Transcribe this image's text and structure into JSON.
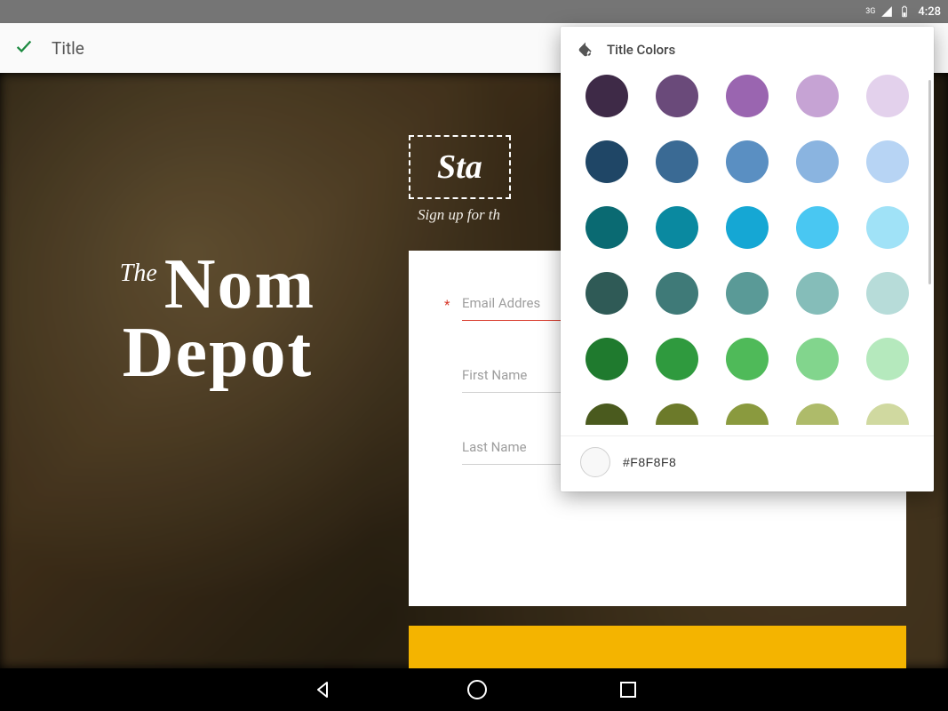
{
  "statusbar": {
    "network_label": "3G",
    "clock": "4:28"
  },
  "toolbar": {
    "title": "Title"
  },
  "brand": {
    "prefix": "The",
    "word1": "Nom",
    "word2": "Depot"
  },
  "hero": {
    "headline_partial": "Sta",
    "subtext_partial": "Sign up for th"
  },
  "form": {
    "email_placeholder": "Email Addres",
    "first_name_placeholder": "First Name",
    "last_name_placeholder": "Last Name",
    "required_mark": "*"
  },
  "panel": {
    "title": "Title Colors",
    "hex_value": "#F8F8F8",
    "swatches": [
      "#3e2a47",
      "#6a4a7a",
      "#9a65b0",
      "#c6a3d4",
      "#e3d1ec",
      "#1f4666",
      "#3a6a94",
      "#5a8fc2",
      "#8ab4e0",
      "#b7d4f4",
      "#0a6a72",
      "#0a89a0",
      "#15a7d4",
      "#49c7f2",
      "#a0e2f7",
      "#2f5a56",
      "#3f7a78",
      "#5a9a97",
      "#85bdb9",
      "#b7dcd9",
      "#1f7a2e",
      "#2f9a3e",
      "#4fba59",
      "#82d58d",
      "#b5e9bd",
      "#4a5a1e",
      "#6c7a2a",
      "#8a9a3e",
      "#aebb6a",
      "#d0d9a0"
    ]
  }
}
